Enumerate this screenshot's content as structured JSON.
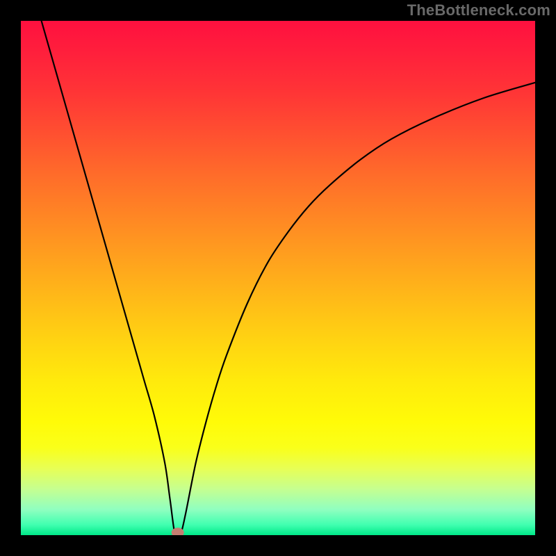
{
  "watermark": "TheBottleneck.com",
  "chart_data": {
    "type": "line",
    "title": "",
    "xlabel": "",
    "ylabel": "",
    "xlim": [
      0,
      100
    ],
    "ylim": [
      0,
      100
    ],
    "series": [
      {
        "name": "bottleneck-curve",
        "x": [
          4,
          6,
          8,
          10,
          12,
          14,
          16,
          18,
          20,
          22,
          24,
          26,
          28,
          29,
          30,
          31,
          32,
          34,
          36,
          38,
          40,
          44,
          48,
          52,
          56,
          60,
          66,
          72,
          80,
          90,
          100
        ],
        "y": [
          100,
          93,
          86,
          79,
          72,
          65,
          58,
          51,
          44,
          37,
          30,
          23,
          14,
          7,
          0,
          0,
          4,
          14,
          22,
          29,
          35,
          45,
          53,
          59,
          64,
          68,
          73,
          77,
          81,
          85,
          88
        ]
      }
    ],
    "marker": {
      "x": 30.5,
      "y": 0.5,
      "color": "#c57e72"
    },
    "gradient_stops": [
      {
        "pos": 0.0,
        "color": "#ff103f"
      },
      {
        "pos": 0.5,
        "color": "#ffc016"
      },
      {
        "pos": 0.8,
        "color": "#fffb08"
      },
      {
        "pos": 1.0,
        "color": "#00e888"
      }
    ]
  }
}
